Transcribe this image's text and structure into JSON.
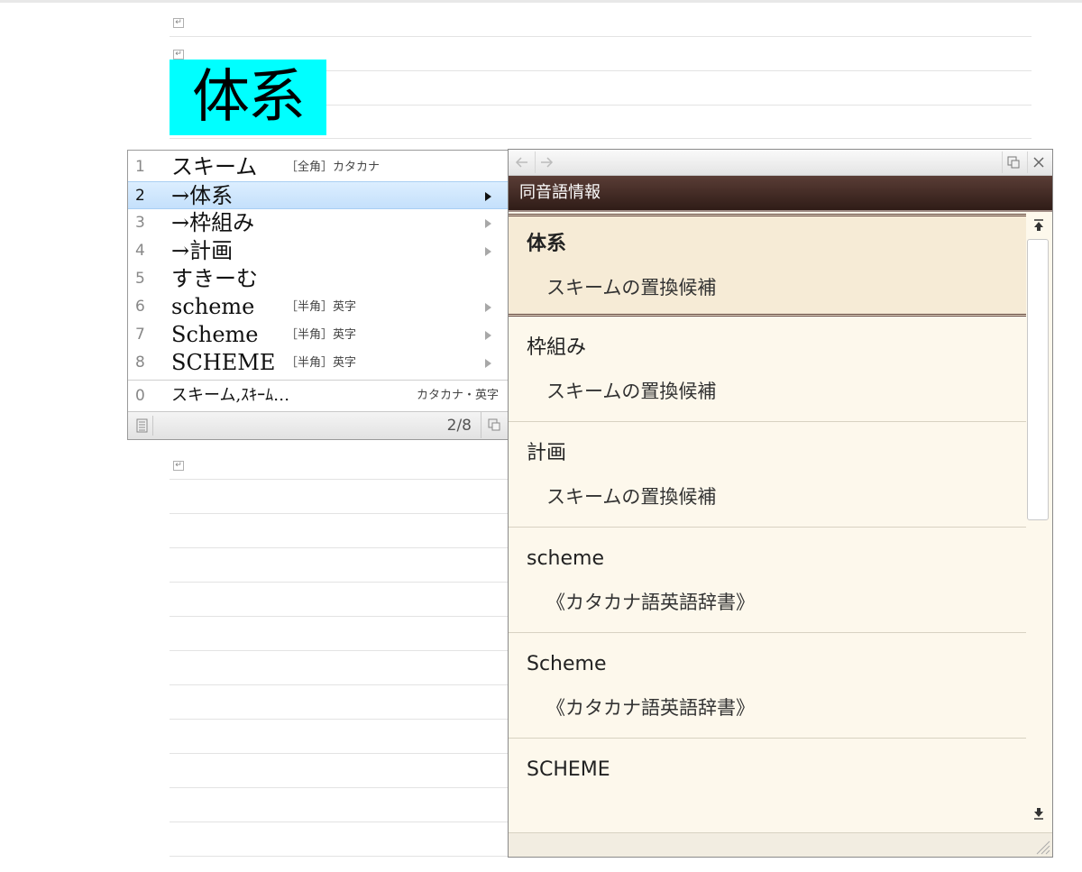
{
  "document": {
    "composed_text": "体系",
    "para_mark": "↵"
  },
  "candidates": {
    "items": [
      {
        "num": "1",
        "text": "スキーム",
        "annotation": "［全角］カタカナ",
        "has_arrow": false
      },
      {
        "num": "2",
        "text": "→体系",
        "annotation": "",
        "has_arrow": true,
        "selected": true
      },
      {
        "num": "3",
        "text": "→枠組み",
        "annotation": "",
        "has_arrow": true
      },
      {
        "num": "4",
        "text": "→計画",
        "annotation": "",
        "has_arrow": true
      },
      {
        "num": "5",
        "text": "すきーむ",
        "annotation": "",
        "has_arrow": false
      },
      {
        "num": "6",
        "text": "scheme",
        "annotation": "［半角］英字",
        "has_arrow": true
      },
      {
        "num": "7",
        "text": "Scheme",
        "annotation": "［半角］英字",
        "has_arrow": true
      },
      {
        "num": "8",
        "text": "SCHEME",
        "annotation": "［半角］英字",
        "has_arrow": true
      }
    ],
    "zero": {
      "num": "0",
      "text": "スキーム,ｽｷｰﾑ…",
      "annotation": "カタカナ・英字"
    },
    "page": "2/8"
  },
  "info": {
    "title": "同音語情報",
    "entries": [
      {
        "head": "体系",
        "sub": "スキームの置換候補",
        "active": true
      },
      {
        "head": "枠組み",
        "sub": "スキームの置換候補"
      },
      {
        "head": "計画",
        "sub": "スキームの置換候補"
      },
      {
        "head": "scheme",
        "sub": "《カタカナ語英語辞書》"
      },
      {
        "head": "Scheme",
        "sub": "《カタカナ語英語辞書》"
      },
      {
        "head": "SCHEME",
        "sub": ""
      }
    ]
  },
  "icons": {
    "back": "back-arrow-icon",
    "forward": "forward-arrow-icon",
    "restore": "restore-window-icon",
    "close": "close-icon",
    "scroll_up": "scroll-up-icon",
    "scroll_down": "scroll-down-icon",
    "dictionary": "dictionary-icon",
    "expand": "expand-window-icon",
    "grip": "resize-grip-icon"
  },
  "colors": {
    "highlight": "#00ffff",
    "titlebar": "#3d2620",
    "selection": "#c4e0fb",
    "info_background": "#fdf8ec"
  }
}
